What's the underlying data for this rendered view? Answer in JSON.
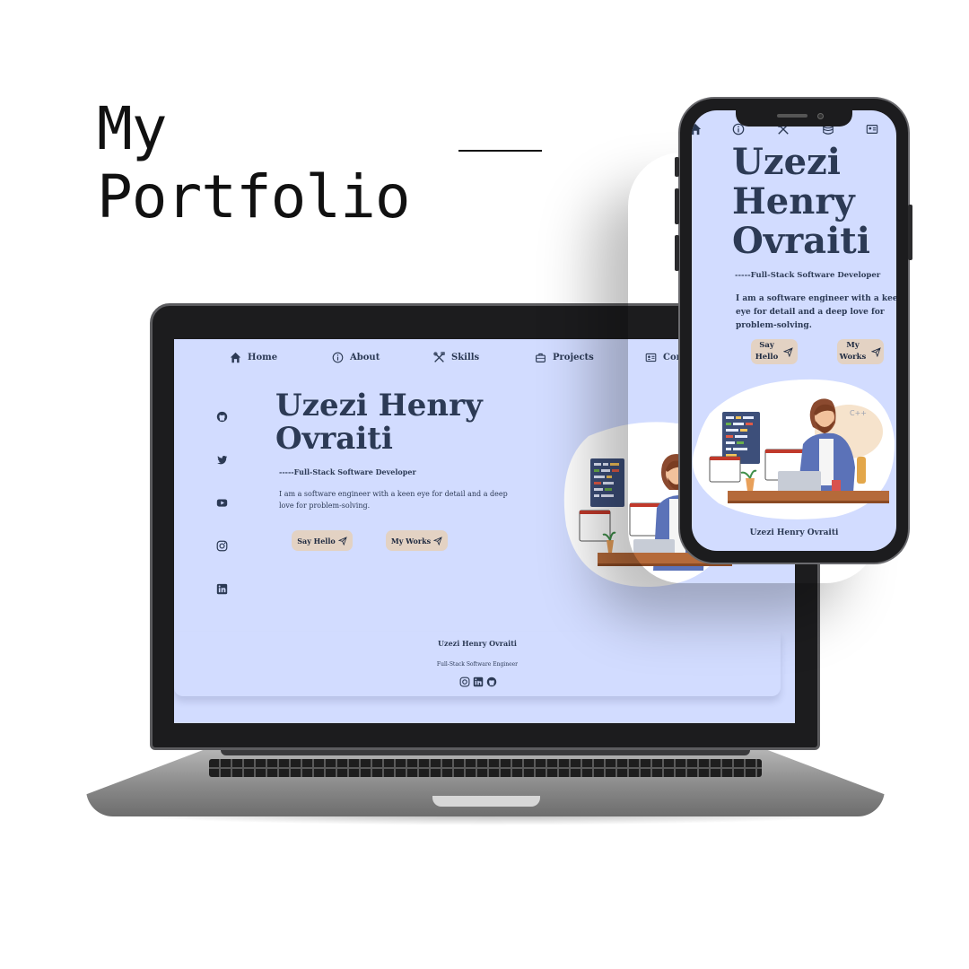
{
  "heading": {
    "line1": "My",
    "line2": "Portfolio"
  },
  "colors": {
    "screen_bg": "#d2dcff",
    "button_bg": "#e3d2c3",
    "text": "#2c3a55"
  },
  "laptop": {
    "nav": [
      {
        "icon": "home-icon",
        "label": "Home"
      },
      {
        "icon": "info-icon",
        "label": "About"
      },
      {
        "icon": "tools-icon",
        "label": "Skills"
      },
      {
        "icon": "briefcase-icon",
        "label": "Projects"
      },
      {
        "icon": "contact-card-icon",
        "label": "Con"
      }
    ],
    "socials": [
      "github-icon",
      "twitter-icon",
      "youtube-icon",
      "instagram-icon",
      "linkedin-icon"
    ],
    "name": "Uzezi Henry Ovraiti",
    "role": "-----Full-Stack Software Developer",
    "bio": "I am a software engineer with a keen eye for detail and a deep love for problem-solving.",
    "buttons": {
      "say_hello": "Say Hello",
      "my_works": "My Works"
    },
    "footer": {
      "name": "Uzezi Henry Ovraiti",
      "role": "Full-Stack Software Engineer",
      "icons": [
        "instagram-icon",
        "linkedin-icon",
        "github-icon"
      ]
    }
  },
  "phone": {
    "nav_icons": [
      "home-icon",
      "info-icon",
      "tools-icon",
      "database-icon",
      "contact-card-icon"
    ],
    "name_lines": [
      "Uzezi",
      "Henry",
      "Ovraiti"
    ],
    "role": "-----Full-Stack Software Developer",
    "bio": "I am a software engineer with a keen eye for detail and a deep love for problem-solving.",
    "buttons": {
      "say_hello_l1": "Say",
      "say_hello_l2": "Hello",
      "my_works_l1": "My",
      "my_works_l2": "Works"
    },
    "illustration_badge": "C++",
    "footer": "Uzezi Henry Ovraiti"
  }
}
